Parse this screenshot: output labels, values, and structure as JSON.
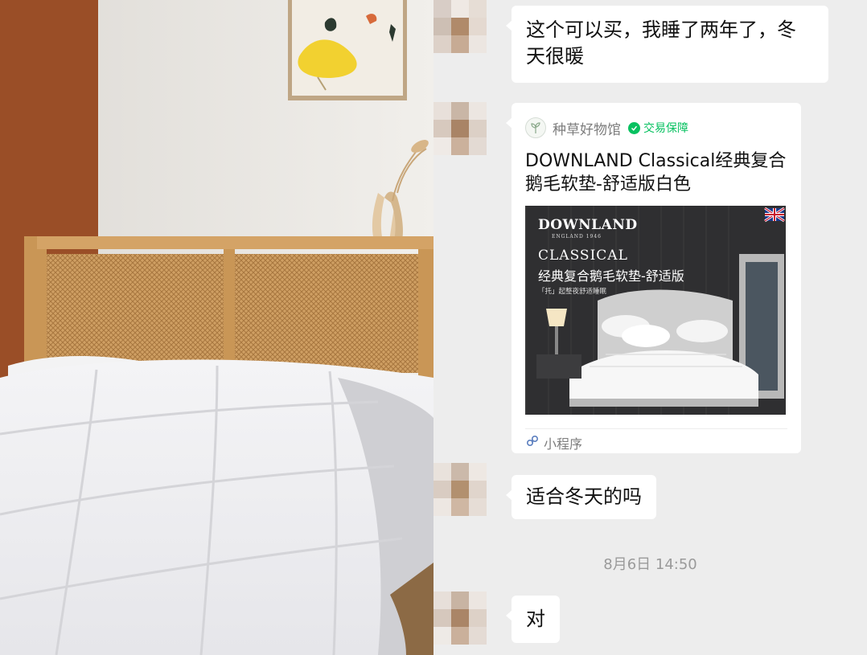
{
  "messages": [
    {
      "id": "msg1",
      "text": "这个可以买，我睡了两年了，冬\n天很暖"
    },
    {
      "id": "msg2",
      "text": "适合冬天的吗"
    },
    {
      "id": "msg3",
      "text": "对"
    }
  ],
  "card": {
    "source_name": "种草好物馆",
    "guarantee_label": "交易保障",
    "title": "DOWNLAND Classical经典复合鹅毛软垫-舒适版白色",
    "image": {
      "brand": "DOWNLAND",
      "brand_sub": "ENGLAND 1946",
      "series": "CLASSICAL",
      "product": "经典复合鹅毛软垫-舒适版",
      "tagline": "「托」起整夜舒适睡眠"
    },
    "footer_label": "小程序"
  },
  "timestamp": "8月6日 14:50",
  "colors": {
    "chat_background": "#ededed",
    "bubble": "#ffffff",
    "guarantee_green": "#07c160",
    "meta_gray": "#9a9a9a"
  },
  "icons": {
    "card_logo": "sprout-logo-icon",
    "guarantee": "shield-check-icon",
    "mini_program": "mini-program-link-icon",
    "flag": "union-jack-flag-icon"
  }
}
